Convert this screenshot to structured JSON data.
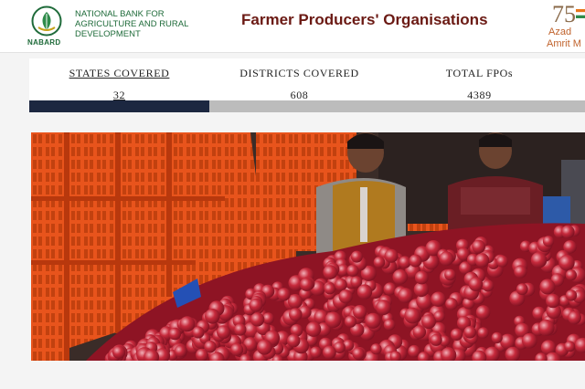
{
  "header": {
    "logo_text": "NABARD",
    "bank_name": "NATIONAL BANK FOR AGRICULTURE AND RURAL DEVELOPMENT",
    "title": "Farmer Producers' Organisations",
    "azadi": {
      "number": "75",
      "line1": "Azad",
      "line2": "Amrit M"
    }
  },
  "stats": [
    {
      "label": "STATES COVERED",
      "value": "32",
      "active": true
    },
    {
      "label": "DISTRICTS COVERED",
      "value": "608",
      "active": false
    },
    {
      "label": "TOTAL FPOs",
      "value": "4389",
      "active": false
    }
  ],
  "colors": {
    "brand_green": "#1f6b3a",
    "title_maroon": "#6b1a14",
    "tab_active": "#1c2740",
    "crate_orange": "#e8541c",
    "apple_red": "#b21c2c"
  },
  "photo": {}
}
